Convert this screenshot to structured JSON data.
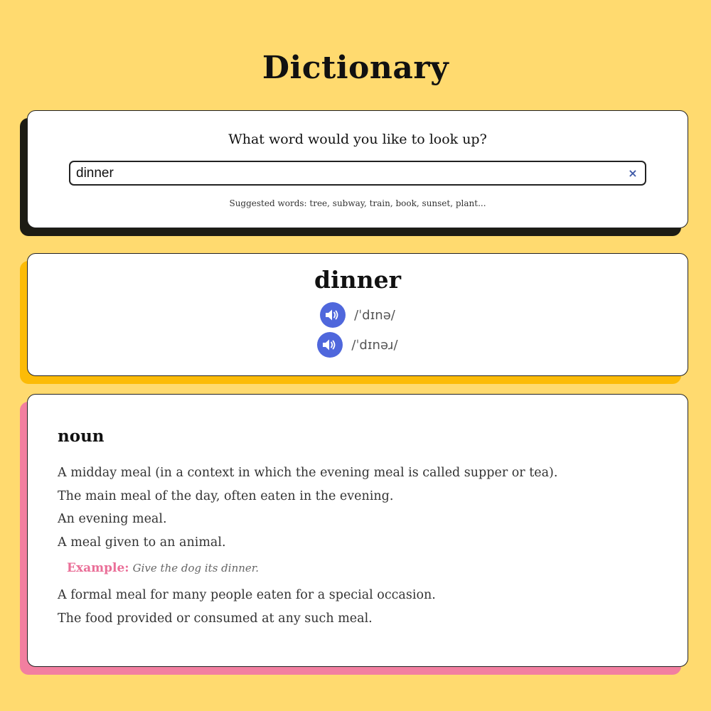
{
  "app": {
    "title": "Dictionary"
  },
  "search": {
    "question": "What word would you like to look up?",
    "value": "dinner",
    "clear_icon": "×",
    "suggestions": "Suggested words: tree, subway, train, book, sunset, plant..."
  },
  "word": {
    "text": "dinner",
    "phonetics": [
      {
        "text": "/ˈdɪnə/",
        "icon": "speaker-icon"
      },
      {
        "text": "/ˈdɪnəɹ/",
        "icon": "speaker-icon"
      }
    ]
  },
  "meaning": {
    "part_of_speech": "noun",
    "definitions": [
      "A midday meal (in a context in which the evening meal is called supper or tea).",
      "The main meal of the day, often eaten in the evening.",
      "An evening meal.",
      "A meal given to an animal."
    ],
    "example_label": "Example:",
    "example_text": "Give the dog its dinner.",
    "more_definitions": [
      "A formal meal for many people eaten for a special occasion.",
      "The food provided or consumed at any such meal."
    ]
  },
  "colors": {
    "background": "#ffda6f",
    "search_shadow": "#1d1c14",
    "phonetics_shadow": "#fcbb07",
    "meaning_shadow": "#f27fa0",
    "audio_button": "#4f67dc",
    "clear_icon": "#3f5aa8",
    "example_label": "#ea6f98"
  }
}
